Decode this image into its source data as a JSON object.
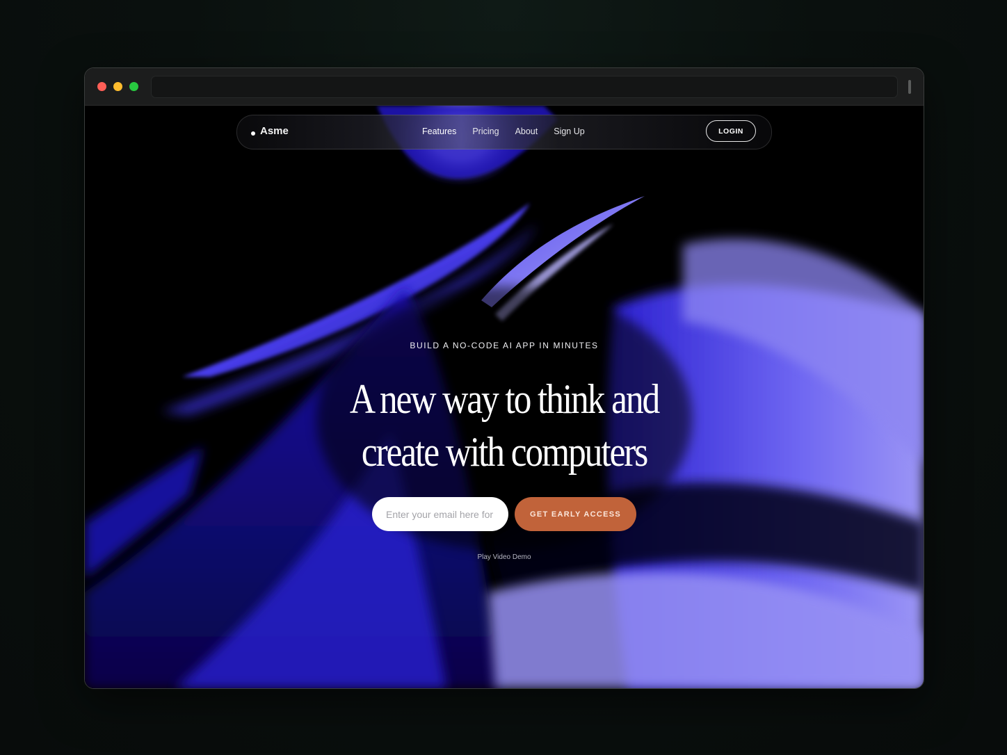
{
  "site": {
    "brand": "Asme"
  },
  "nav": {
    "links": [
      {
        "label": "Features"
      },
      {
        "label": "Pricing"
      },
      {
        "label": "About"
      },
      {
        "label": "Sign Up"
      }
    ],
    "login_label": "LOGIN"
  },
  "hero": {
    "eyebrow": "BUILD A NO-CODE AI APP IN MINUTES",
    "headline_line1": "A new way to think and",
    "headline_line2": "create with computers",
    "email_placeholder": "Enter your email here for",
    "cta_label": "GET EARLY ACCESS",
    "play_demo_label": "Play Video Demo"
  },
  "colors": {
    "page_background": "#0a100e",
    "accent_button": "#c1633a",
    "hero_background": "#000000",
    "art_primary": "#3426d8",
    "art_highlight": "#8a84f0"
  }
}
